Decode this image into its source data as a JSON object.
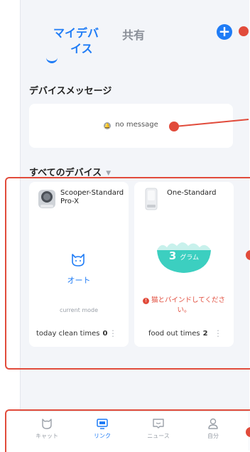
{
  "header": {
    "tab_my_devices_line1": "マイデバ",
    "tab_my_devices_line2": "イス",
    "tab_shared": "共有",
    "add_label": "+"
  },
  "messages": {
    "title": "デバイスメッセージ",
    "empty_text": "no message"
  },
  "devices": {
    "title": "すべてのデバイス",
    "dropdown_glyph": "▼",
    "items": [
      {
        "name_line1": "Scooper-Standard",
        "name_line2": "Pro-X",
        "mode": "オート",
        "mode_caption": "current mode",
        "footer_label": "today clean times",
        "footer_value": "0",
        "more": "⋮"
      },
      {
        "name": "One-Standard",
        "food_amount": "3",
        "food_unit": "グラム",
        "warning": "猫とバインドしてください。",
        "footer_label": "food out times",
        "footer_value": "2",
        "more": "⋮"
      }
    ]
  },
  "bottom_nav": {
    "items": [
      {
        "label": "キャット",
        "icon": "cat-icon"
      },
      {
        "label": "リンク",
        "icon": "link-device-icon",
        "active": true
      },
      {
        "label": "ニュース",
        "icon": "news-icon"
      },
      {
        "label": "自分",
        "icon": "profile-icon"
      }
    ]
  },
  "colors": {
    "accent": "#1f7cf6",
    "warning": "#e14b3b",
    "food_bowl": "#3ccfc0",
    "annotation": "#e14b3b"
  }
}
